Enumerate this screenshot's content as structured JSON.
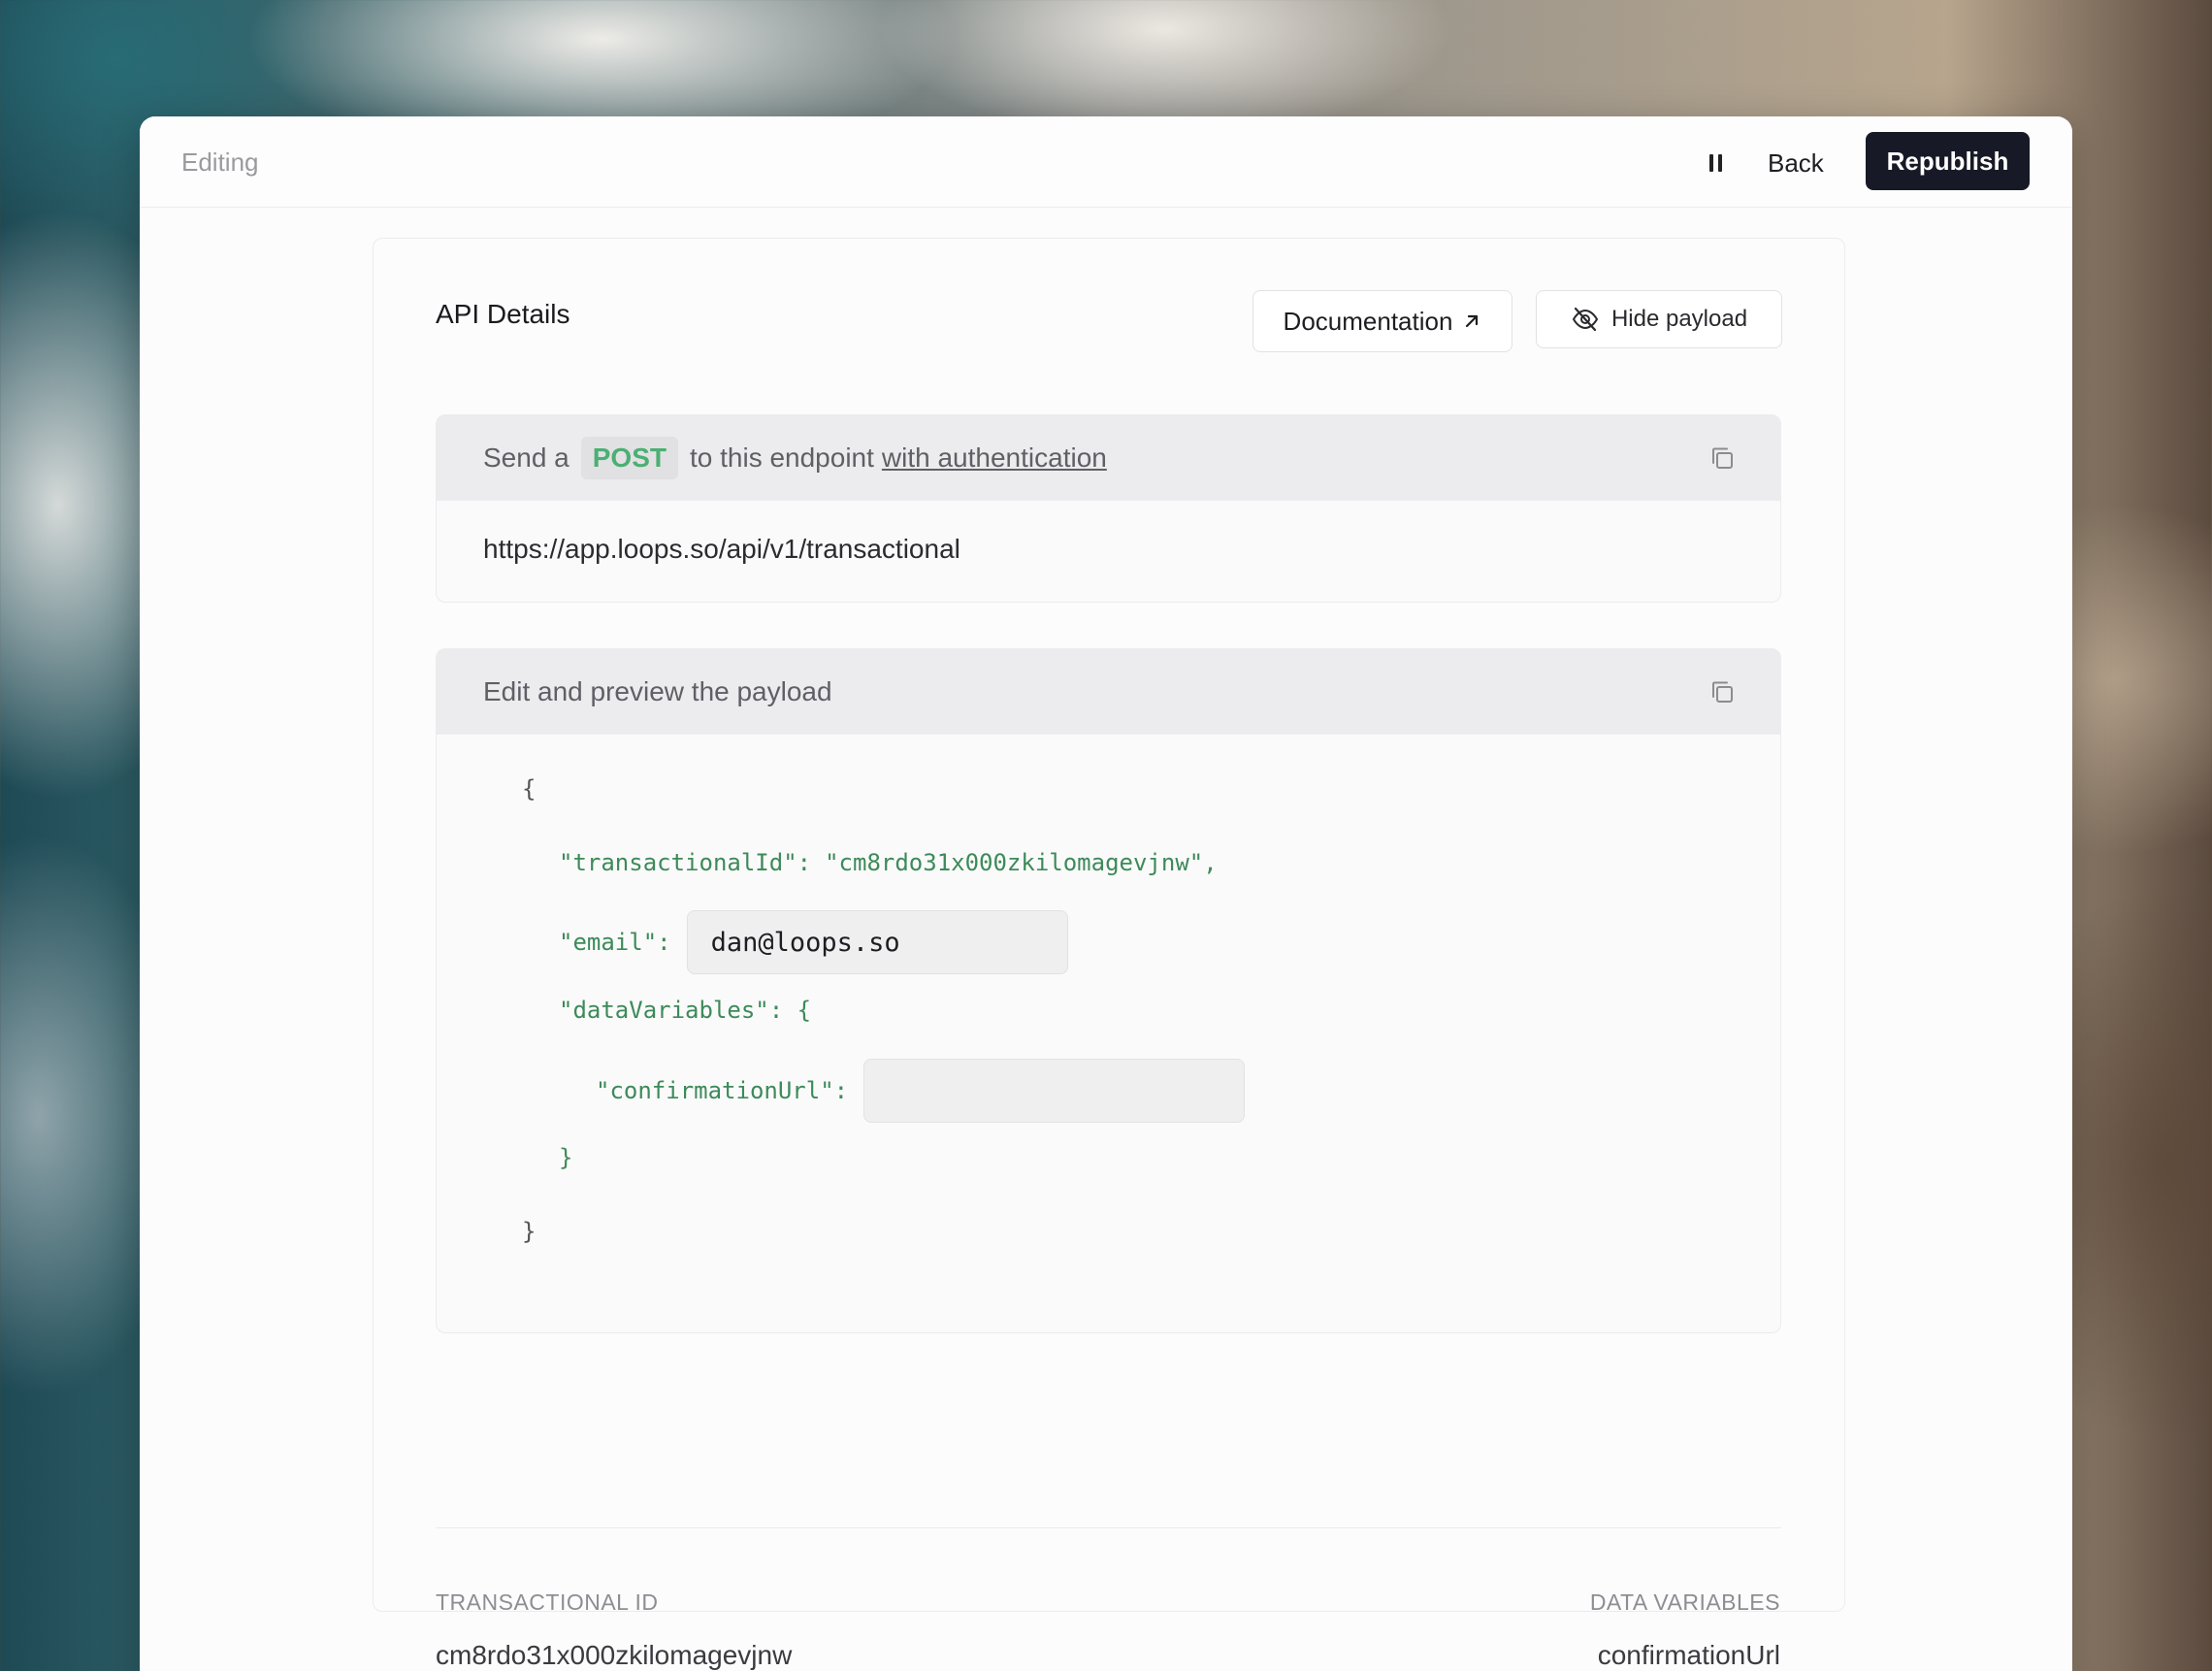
{
  "topbar": {
    "status": "Editing",
    "back_label": "Back",
    "republish_label": "Republish"
  },
  "card": {
    "title": "API Details",
    "documentation_label": "Documentation",
    "hide_payload_label": "Hide payload"
  },
  "endpoint": {
    "prefix": "Send a",
    "method": "POST",
    "middle": "to this endpoint",
    "auth_link": "with authentication",
    "url": "https://app.loops.so/api/v1/transactional"
  },
  "payload": {
    "header": "Edit and preview the payload",
    "open_brace": "{",
    "close_brace": "}",
    "transactional_key": "\"transactionalId\":",
    "transactional_value": "\"cm8rdo31x000zkilomagevjnw\",",
    "email_key": "\"email\":",
    "email_value": "dan@loops.so",
    "data_variables_key": "\"dataVariables\": {",
    "confirmation_key": "\"confirmationUrl\":",
    "confirmation_value": "",
    "inner_close": "}"
  },
  "meta": {
    "transactional_label": "TRANSACTIONAL ID",
    "transactional_value": "cm8rdo31x000zkilomagevjnw",
    "data_variables_label": "DATA VARIABLES",
    "data_variables_value": "confirmationUrl"
  },
  "icons": {
    "pause": "pause-icon",
    "external": "arrow-up-right-icon",
    "eye_off": "eye-off-icon",
    "copy": "copy-icon"
  },
  "colors": {
    "primary_button": "#171a26",
    "method_green": "#4caf73",
    "code_green": "#3d8a5a"
  }
}
